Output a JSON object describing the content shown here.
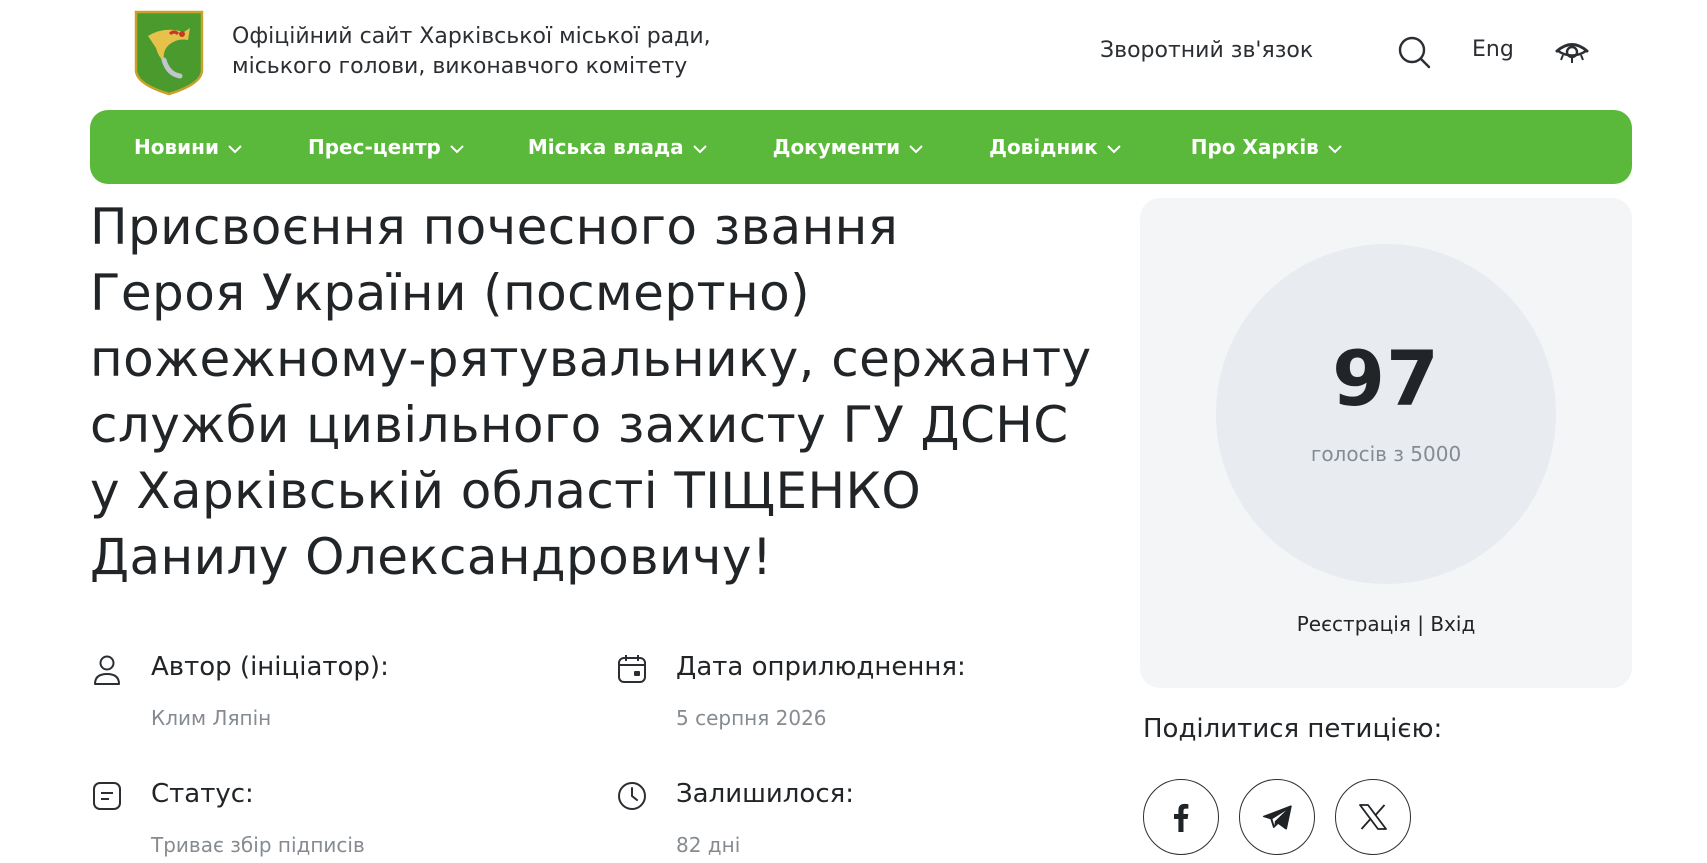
{
  "header": {
    "site_title_line1": "Офіційний сайт Харківської міської ради,",
    "site_title_line2": "міського голови, виконавчого комітету",
    "feedback": "Зворотний зв'язок",
    "lang": "Eng",
    "logo_icon": "kharkiv-coat-of-arms",
    "search_icon": "search-icon",
    "accessibility_icon": "eye-icon"
  },
  "nav": {
    "items": [
      {
        "label": "Новини"
      },
      {
        "label": "Прес-центр"
      },
      {
        "label": "Міська влада"
      },
      {
        "label": "Документи"
      },
      {
        "label": "Довідник"
      },
      {
        "label": "Про Харків"
      }
    ],
    "color": "#5ab83a"
  },
  "petition": {
    "title_lines": [
      "Присвоєння почесного звання",
      "Героя України (посмертно)",
      "пожежному-рятувальнику, сержанту",
      "служби цивільного захисту ГУ ДСНС",
      "у Харківській області ТІЩЕНКО",
      "Данилу Олександровичу!"
    ],
    "author_label": "Автор (ініціатор):",
    "author_value": "Клим Ляпін",
    "date_label": "Дата оприлюднення:",
    "date_value": "5 серпня 2026",
    "status_label": "Статус:",
    "status_value": "Триває збір підписів",
    "remaining_label": "Залишилося:",
    "remaining_value": "82 дні"
  },
  "votes": {
    "count": "97",
    "subtitle": "голосів з 5000",
    "register": "Реєстрація",
    "separator": "|",
    "login": "Вхід"
  },
  "share": {
    "label": "Поділитися петицією:",
    "icons": [
      "facebook-icon",
      "telegram-icon",
      "x-icon"
    ]
  }
}
